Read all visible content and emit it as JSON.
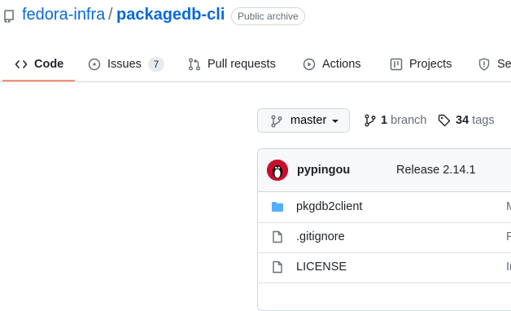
{
  "repo": {
    "owner": "fedora-infra",
    "separator": "/",
    "name": "packagedb-cli",
    "badge": "Public archive"
  },
  "tabs": [
    {
      "label": "Code",
      "icon": "code-icon",
      "active": true
    },
    {
      "label": "Issues",
      "icon": "issue-icon",
      "count": "7"
    },
    {
      "label": "Pull requests",
      "icon": "pull-request-icon"
    },
    {
      "label": "Actions",
      "icon": "play-icon"
    },
    {
      "label": "Projects",
      "icon": "table-icon"
    },
    {
      "label": "Se",
      "icon": "shield-icon"
    }
  ],
  "branch": {
    "current": "master",
    "branch_count": "1",
    "branch_label": "branch",
    "tag_count": "34",
    "tag_label": "tags"
  },
  "latest_commit": {
    "author": "pypingou",
    "message": "Release 2.14.1"
  },
  "files": [
    {
      "name": "pkgdb2client",
      "type": "folder",
      "message": "M"
    },
    {
      "name": ".gitignore",
      "type": "file",
      "message": "F"
    },
    {
      "name": "LICENSE",
      "type": "file",
      "message": "In"
    }
  ],
  "colors": {
    "link": "#0969da",
    "active_tab_underline": "#fd8c73",
    "folder": "#54aeff"
  }
}
